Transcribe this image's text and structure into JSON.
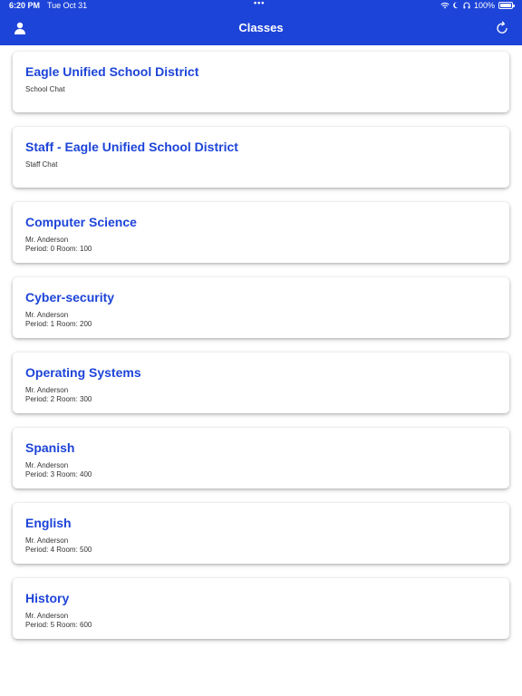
{
  "status": {
    "time": "6:20 PM",
    "date": "Tue Oct 31",
    "battery": "100%"
  },
  "nav": {
    "title": "Classes",
    "left_icon": "person-icon",
    "right_icon": "refresh-icon"
  },
  "colors": {
    "accent": "#1d44d8"
  },
  "classes": [
    {
      "title": "Eagle Unified School District",
      "line1": "School Chat",
      "line2": ""
    },
    {
      "title": "Staff - Eagle Unified School District",
      "line1": "Staff Chat",
      "line2": ""
    },
    {
      "title": "Computer Science",
      "line1": "Mr. Anderson",
      "line2": "Period: 0 Room: 100"
    },
    {
      "title": "Cyber-security",
      "line1": "Mr. Anderson",
      "line2": "Period: 1 Room: 200"
    },
    {
      "title": "Operating Systems",
      "line1": "Mr. Anderson",
      "line2": "Period: 2 Room: 300"
    },
    {
      "title": "Spanish",
      "line1": "Mr. Anderson",
      "line2": "Period: 3 Room: 400"
    },
    {
      "title": "English",
      "line1": "Mr. Anderson",
      "line2": "Period: 4 Room: 500"
    },
    {
      "title": "History",
      "line1": "Mr. Anderson",
      "line2": "Period: 5 Room: 600"
    }
  ]
}
